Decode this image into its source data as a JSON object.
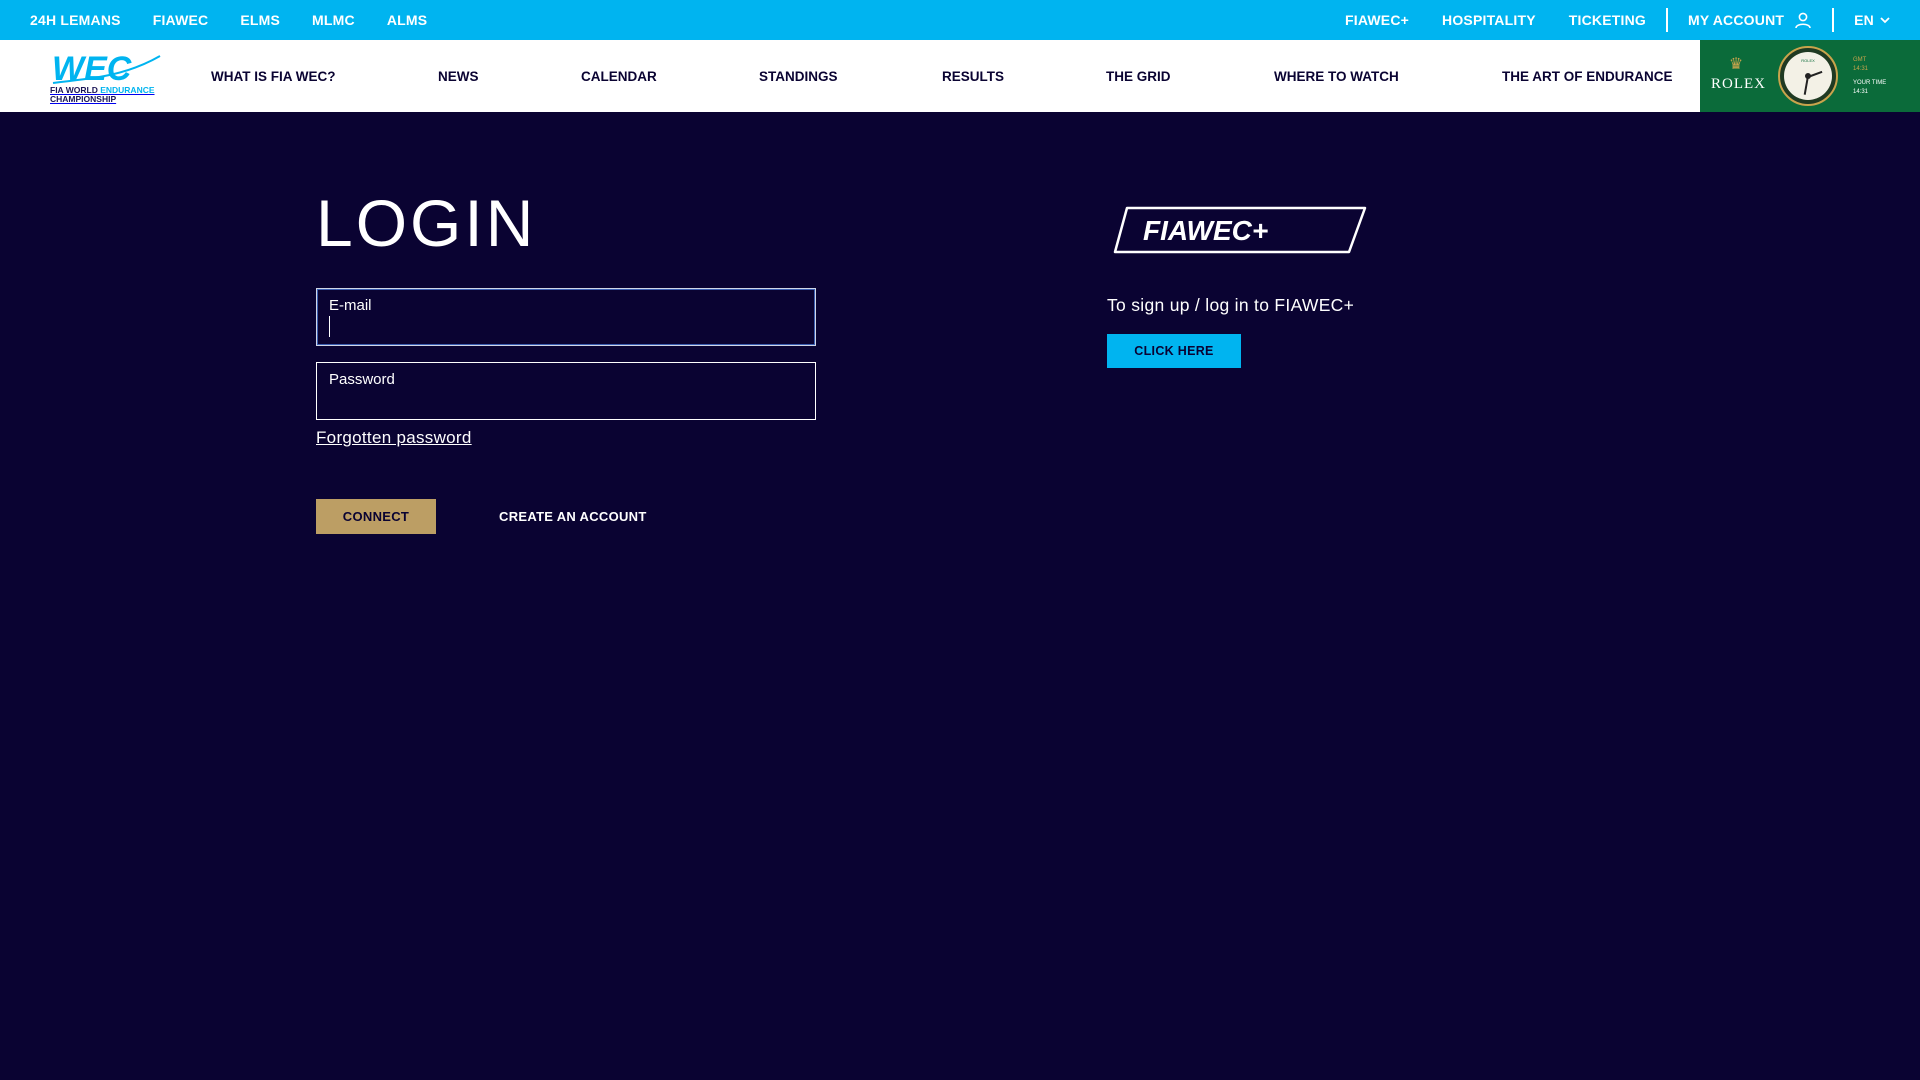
{
  "topbar": {
    "left_links": [
      "24H LEMANS",
      "FIAWEC",
      "ELMS",
      "MLMC",
      "ALMS"
    ],
    "right_links": [
      "FIAWEC+",
      "HOSPITALITY",
      "TICKETING"
    ],
    "account_label": "MY ACCOUNT",
    "language": "EN"
  },
  "logo": {
    "wordmark": "WEC",
    "subtitle_line1_a": "FIA WORLD ",
    "subtitle_line1_b": "ENDURANCE",
    "subtitle_line2": "CHAMPIONSHIP"
  },
  "nav": {
    "items": [
      "WHAT IS FIA WEC?",
      "NEWS",
      "CALENDAR",
      "STANDINGS",
      "RESULTS",
      "THE GRID",
      "WHERE TO WATCH",
      "THE ART OF ENDURANCE"
    ]
  },
  "rolex": {
    "brand": "ROLEX",
    "dial_brand": "ROLEX",
    "gmt_label": "GMT",
    "gmt_time": "14:31",
    "your_time_label": "YOUR TIME",
    "your_time": "14:31"
  },
  "login": {
    "title": "LOGIN",
    "email_label": "E-mail",
    "password_label": "Password",
    "forgot": "Forgotten password",
    "connect": "CONNECT",
    "create_account": "CREATE AN ACCOUNT"
  },
  "fiawec_plus": {
    "logo_text": "FIAWEC+",
    "text": "To sign up / log in to FIAWEC+",
    "button": "CLICK HERE"
  },
  "colors": {
    "background": "#0a0332",
    "topbar": "#00b4f0",
    "connect_button": "#bc9e64",
    "click_button": "#00b4f0",
    "rolex_green": "#0b6b3a"
  }
}
